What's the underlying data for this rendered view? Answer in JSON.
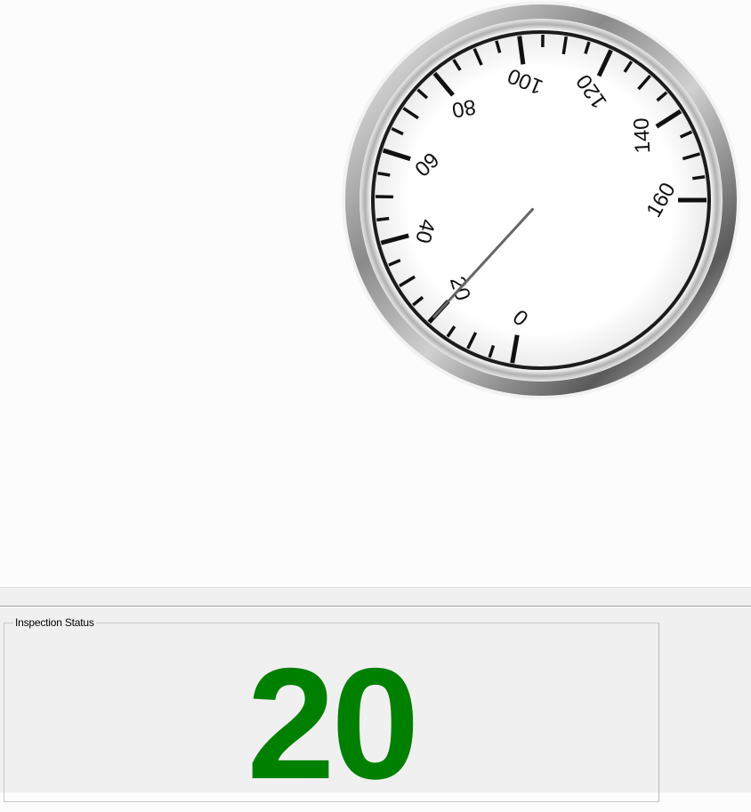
{
  "gauge": {
    "min": 0,
    "max": 160,
    "major_step": 20,
    "minor_step": 5,
    "value": 20,
    "labels": [
      "0",
      "20",
      "40",
      "60",
      "80",
      "100",
      "120",
      "140",
      "160"
    ],
    "needle_color": "#666666",
    "tick_color": "#111111"
  },
  "inspection": {
    "group_label": "Inspection Status",
    "value": "20",
    "value_color": "#008000"
  }
}
